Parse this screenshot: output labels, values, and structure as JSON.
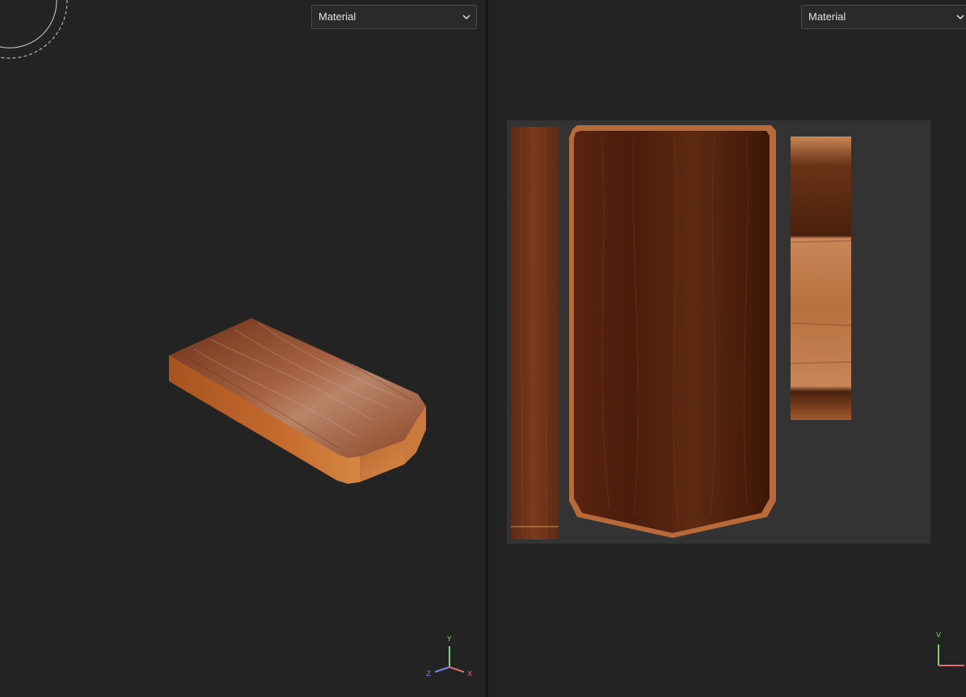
{
  "left_viewport": {
    "shading_mode": "Material",
    "axis_gizmo": {
      "y": "Y",
      "z": "Z",
      "x": "X"
    }
  },
  "right_viewport": {
    "shading_mode": "Material",
    "axis_gizmo": {
      "v": "V"
    }
  },
  "colors": {
    "background": "#232323",
    "uv_tile": "#333333",
    "wood_dark": "#4a1f0b",
    "wood_mid": "#8a4522",
    "wood_light": "#c97a45",
    "axis_x": "#e06b6b",
    "axis_y": "#7fd36a",
    "axis_z": "#7d82e0"
  },
  "icons": [
    "chevron-down-icon",
    "rotate-circle-icon",
    "axis-gizmo-icon",
    "uv-axis-icon"
  ]
}
